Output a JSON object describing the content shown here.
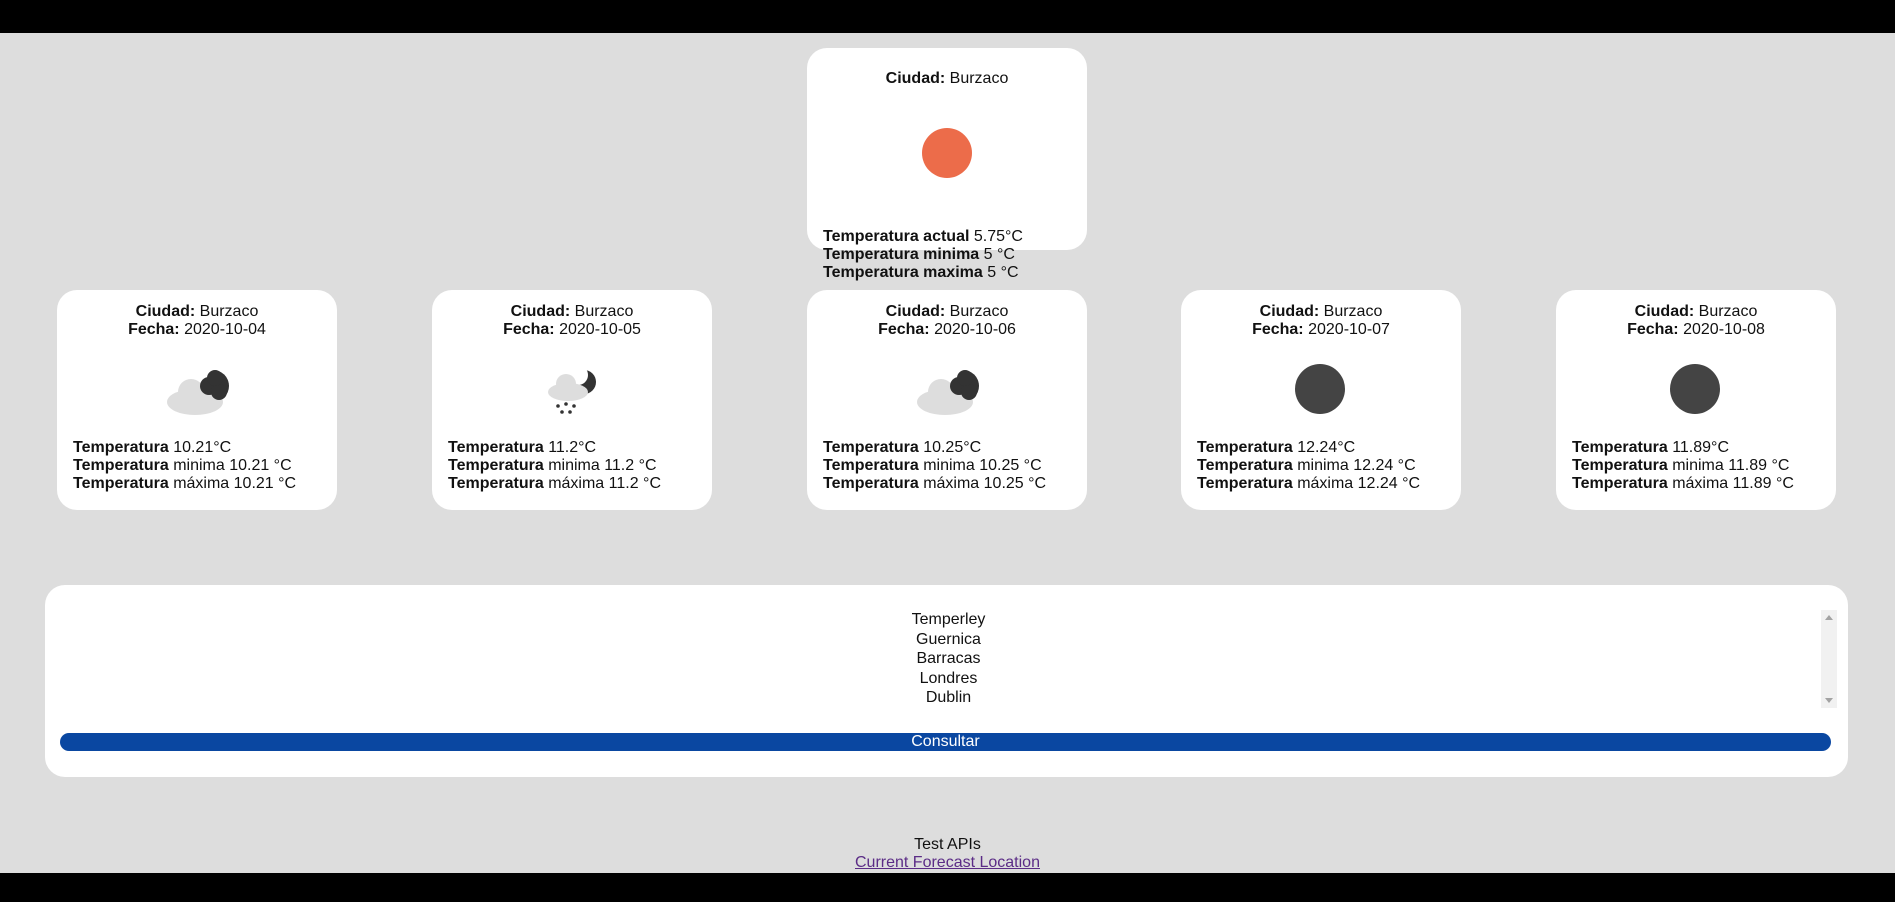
{
  "current": {
    "city_label": "Ciudad:",
    "city": "Burzaco",
    "lines": [
      {
        "label": "Temperatura actual",
        "value": "5.75°C"
      },
      {
        "label": "Temperatura minima",
        "value": "5 °C"
      },
      {
        "label": "Temperatura maxima",
        "value": "5 °C"
      }
    ],
    "icon": "sun-icon",
    "icon_color": "#ec6c4a"
  },
  "forecast": [
    {
      "city_label": "Ciudad:",
      "city": "Burzaco",
      "date_label": "Fecha:",
      "date": "2020-10-04",
      "icon": "partly-cloudy-night-icon",
      "temp_label": "Temperatura",
      "temp": "10.21°C",
      "min": "minima 10.21 °C",
      "max": "máxima 10.21 °C"
    },
    {
      "city_label": "Ciudad:",
      "city": "Burzaco",
      "date_label": "Fecha:",
      "date": "2020-10-05",
      "icon": "snow-night-icon",
      "temp_label": "Temperatura",
      "temp": "11.2°C",
      "min": "minima 11.2 °C",
      "max": "máxima 11.2 °C"
    },
    {
      "city_label": "Ciudad:",
      "city": "Burzaco",
      "date_label": "Fecha:",
      "date": "2020-10-06",
      "icon": "partly-cloudy-night-icon",
      "temp_label": "Temperatura",
      "temp": "10.25°C",
      "min": "minima 10.25 °C",
      "max": "máxima 10.25 °C"
    },
    {
      "city_label": "Ciudad:",
      "city": "Burzaco",
      "date_label": "Fecha:",
      "date": "2020-10-07",
      "icon": "moon-icon",
      "temp_label": "Temperatura",
      "temp": "12.24°C",
      "min": "minima 12.24 °C",
      "max": "máxima 12.24 °C"
    },
    {
      "city_label": "Ciudad:",
      "city": "Burzaco",
      "date_label": "Fecha:",
      "date": "2020-10-08",
      "icon": "moon-icon",
      "temp_label": "Temperatura",
      "temp": "11.89°C",
      "min": "minima 11.89 °C",
      "max": "máxima 11.89 °C"
    }
  ],
  "city_select": {
    "options": [
      "Temperley",
      "Guernica",
      "Barracas",
      "Londres",
      "Dublin"
    ]
  },
  "consult_button": "Consultar",
  "footer": {
    "title": "Test APIs",
    "link": "Current Forecast Location"
  },
  "colors": {
    "button": "#0a47a1",
    "background": "#dddddd",
    "moon": "#444444"
  }
}
